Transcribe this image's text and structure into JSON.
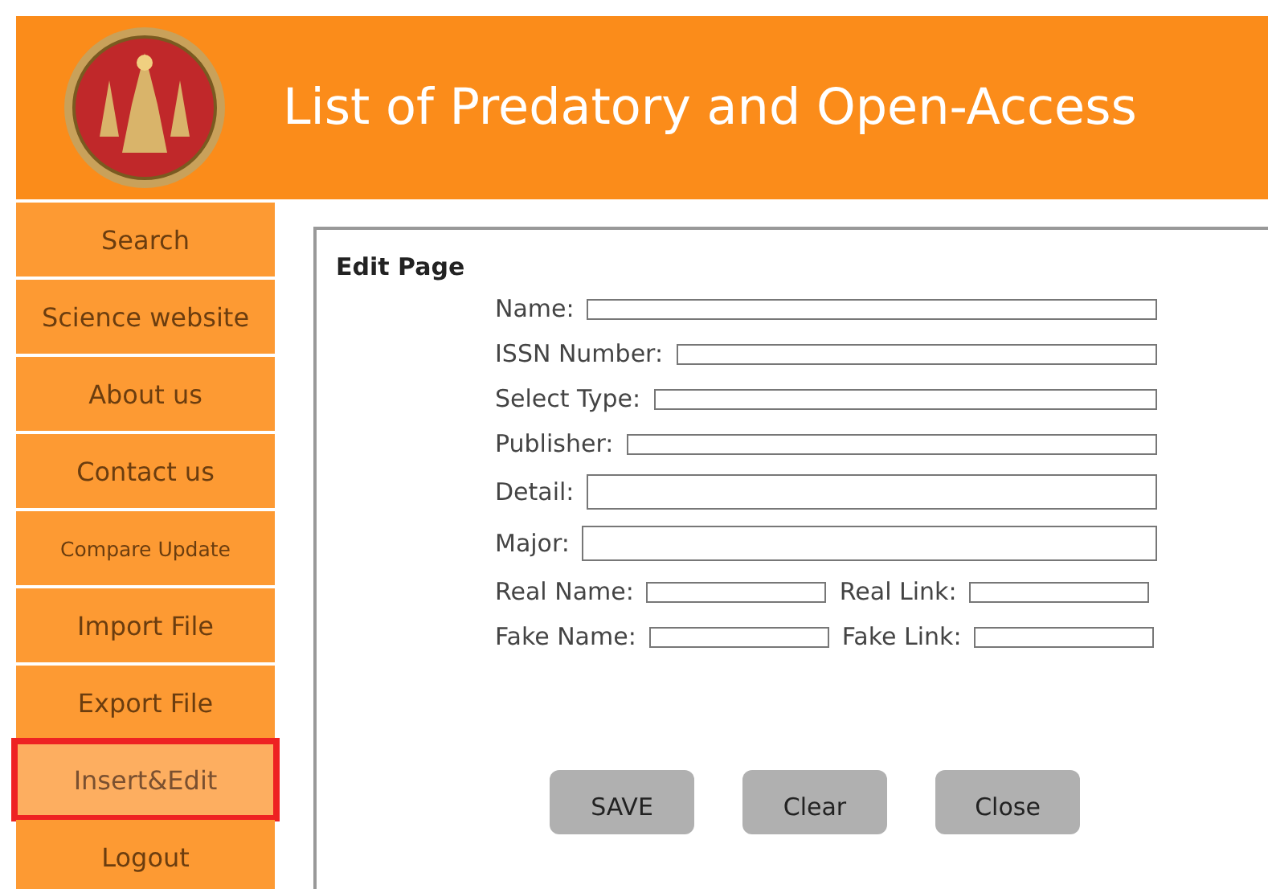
{
  "header": {
    "title": "List of Predatory and Open-Access"
  },
  "sidebar": {
    "items": [
      {
        "label": "Search",
        "selected": false,
        "small": false
      },
      {
        "label": "Science website",
        "selected": false,
        "small": false
      },
      {
        "label": "About us",
        "selected": false,
        "small": false
      },
      {
        "label": "Contact us",
        "selected": false,
        "small": false
      },
      {
        "label": "Compare Update",
        "selected": false,
        "small": true
      },
      {
        "label": "Import File",
        "selected": false,
        "small": false
      },
      {
        "label": "Export File",
        "selected": false,
        "small": false
      },
      {
        "label": "Insert&Edit",
        "selected": true,
        "small": false
      },
      {
        "label": "Logout",
        "selected": false,
        "small": false
      }
    ]
  },
  "form": {
    "title": "Edit Page",
    "rows": [
      {
        "kind": "single",
        "fields": [
          {
            "label": "Name:",
            "kind": "line"
          }
        ]
      },
      {
        "kind": "single",
        "fields": [
          {
            "label": "ISSN Number:",
            "kind": "line"
          }
        ]
      },
      {
        "kind": "single",
        "fields": [
          {
            "label": "Select Type:",
            "kind": "line"
          }
        ]
      },
      {
        "kind": "single",
        "fields": [
          {
            "label": "Publisher:",
            "kind": "line"
          }
        ]
      },
      {
        "kind": "single",
        "fields": [
          {
            "label": "Detail:",
            "kind": "box"
          }
        ]
      },
      {
        "kind": "single",
        "fields": [
          {
            "label": "Major:",
            "kind": "box"
          }
        ]
      },
      {
        "kind": "pair",
        "fields": [
          {
            "label": "Real Name:",
            "kind": "line"
          },
          {
            "label": "Real Link:",
            "kind": "line"
          }
        ]
      },
      {
        "kind": "pair",
        "fields": [
          {
            "label": "Fake Name:",
            "kind": "line"
          },
          {
            "label": "Fake Link:",
            "kind": "line"
          }
        ]
      }
    ],
    "buttons": [
      "SAVE",
      "Clear",
      "Close"
    ]
  }
}
